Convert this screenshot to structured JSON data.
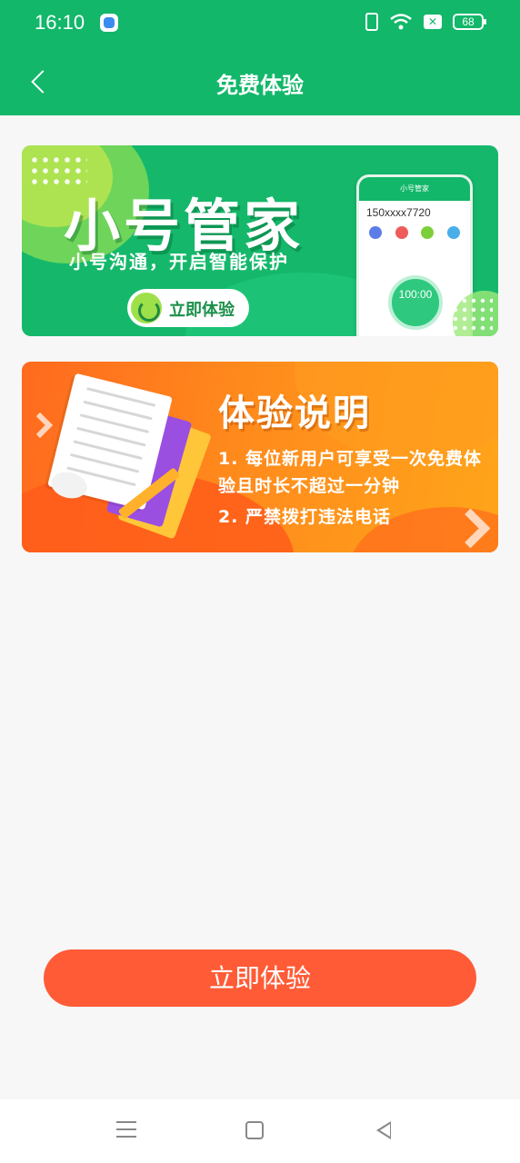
{
  "status_bar": {
    "time": "16:10",
    "battery": "68",
    "icons": [
      "app-notification-icon",
      "vibrate-icon",
      "wifi-icon",
      "sim-icon",
      "battery-icon"
    ]
  },
  "nav": {
    "title": "免费体验",
    "back_icon": "chevron-left-icon"
  },
  "banner_product": {
    "title": "小号管家",
    "subtitle": "小号沟通，开启智能保护",
    "button_label": "立即体验",
    "phone": {
      "header": "小号管家",
      "number": "150xxxx7720",
      "remaining_time": "100:00"
    }
  },
  "banner_info": {
    "title": "体验说明",
    "rules": [
      "1. 每位新用户可享受一次免费体",
      "验且时长不超过一分钟",
      "2. 严禁拨打违法电话"
    ]
  },
  "cta": {
    "label": "立即体验"
  },
  "colors": {
    "brand_green": "#12b76a",
    "cta_orange": "#ff5b36",
    "banner_orange": "#ff8a1c"
  }
}
